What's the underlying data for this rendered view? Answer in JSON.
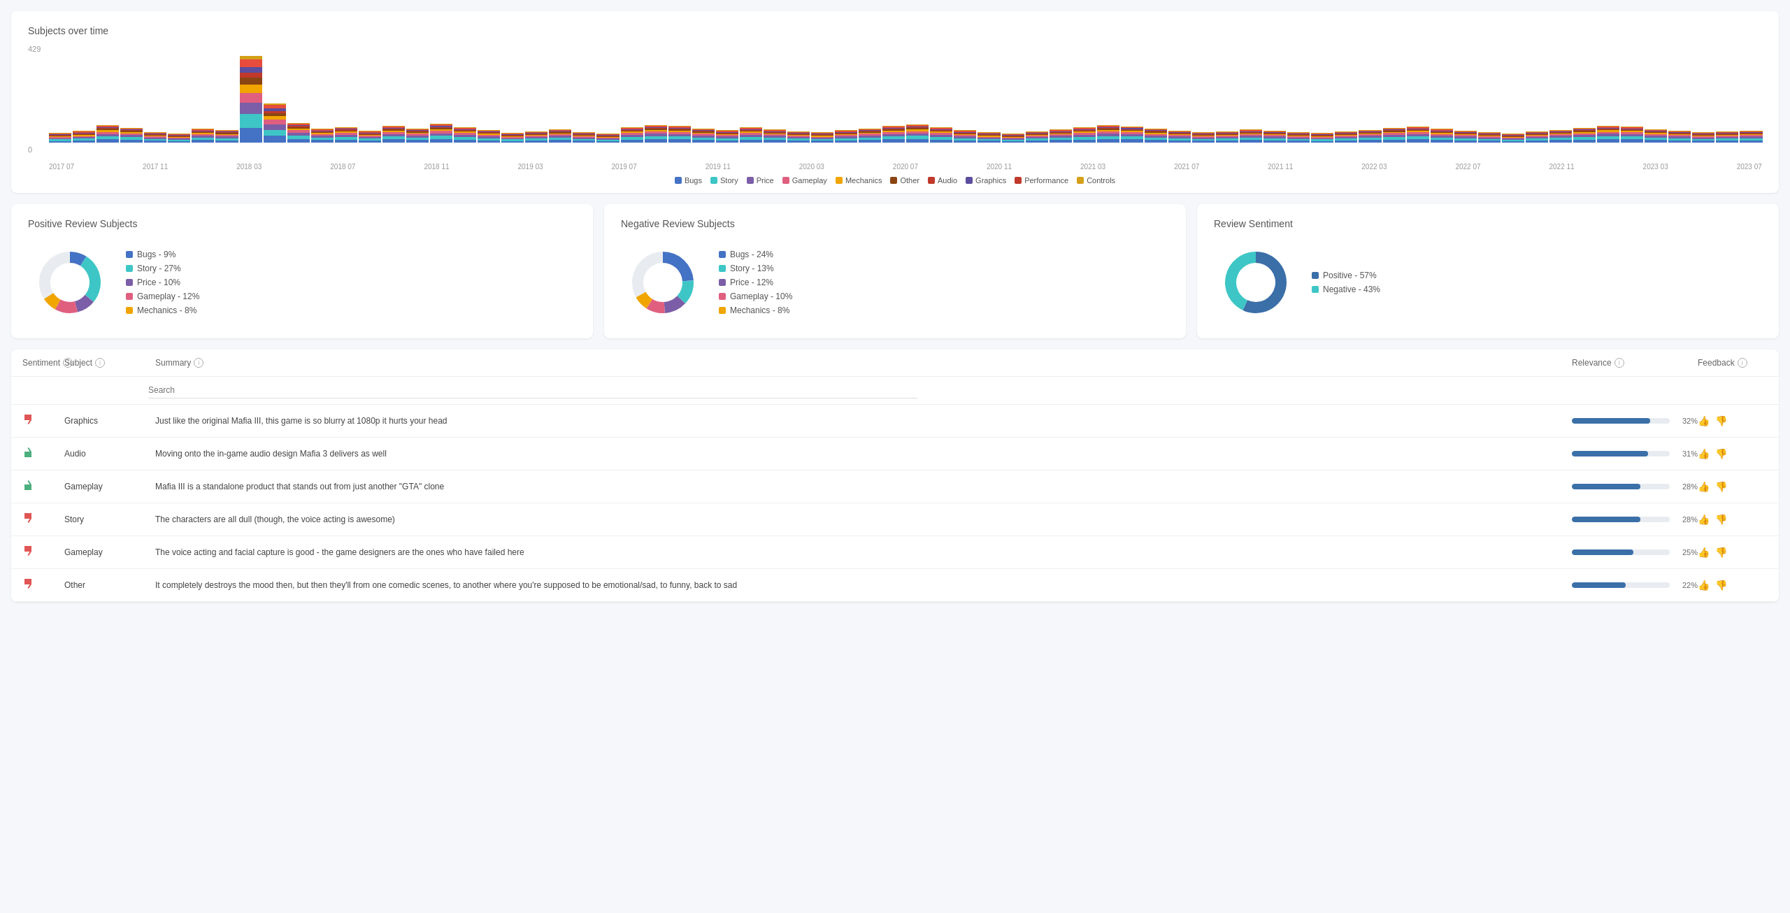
{
  "chart": {
    "title": "Subjects over time",
    "y_max": "429",
    "y_zero": "0",
    "x_labels": [
      "2017 07",
      "2017 11",
      "2018 03",
      "2018 07",
      "2018 11",
      "2019 03",
      "2019 07",
      "2019 11",
      "2020 03",
      "2020 07",
      "2020 11",
      "2021 03",
      "2021 07",
      "2021 11",
      "2022 03",
      "2022 07",
      "2022 11",
      "2023 03",
      "2023 07"
    ],
    "legend": [
      {
        "label": "Bugs",
        "color": "#4472c4"
      },
      {
        "label": "Story",
        "color": "#3ec6c6"
      },
      {
        "label": "Price",
        "color": "#7b5ea7"
      },
      {
        "label": "Gameplay",
        "color": "#e05f7f"
      },
      {
        "label": "Mechanics",
        "color": "#f0a500"
      },
      {
        "label": "Other",
        "color": "#8b4513"
      },
      {
        "label": "Audio",
        "color": "#c0392b"
      },
      {
        "label": "Graphics",
        "color": "#5c4d9e"
      },
      {
        "label": "Performance",
        "color": "#c0392b"
      },
      {
        "label": "Controls",
        "color": "#d4a017"
      }
    ]
  },
  "positive_subjects": {
    "title": "Positive Review Subjects",
    "legend": [
      {
        "label": "Bugs - 9%",
        "color": "#4472c4"
      },
      {
        "label": "Story - 27%",
        "color": "#3ec6c6"
      },
      {
        "label": "Price - 10%",
        "color": "#7b5ea7"
      },
      {
        "label": "Gameplay - 12%",
        "color": "#e05f7f"
      },
      {
        "label": "Mechanics - 8%",
        "color": "#f0a500"
      }
    ],
    "segments": [
      {
        "pct": 9,
        "color": "#4472c4"
      },
      {
        "pct": 27,
        "color": "#3ec6c6"
      },
      {
        "pct": 10,
        "color": "#7b5ea7"
      },
      {
        "pct": 12,
        "color": "#e05f7f"
      },
      {
        "pct": 8,
        "color": "#f0a500"
      },
      {
        "pct": 34,
        "color": "#e8ecf0"
      }
    ]
  },
  "negative_subjects": {
    "title": "Negative Review Subjects",
    "legend": [
      {
        "label": "Bugs - 24%",
        "color": "#4472c4"
      },
      {
        "label": "Story - 13%",
        "color": "#3ec6c6"
      },
      {
        "label": "Price - 12%",
        "color": "#7b5ea7"
      },
      {
        "label": "Gameplay - 10%",
        "color": "#e05f7f"
      },
      {
        "label": "Mechanics - 8%",
        "color": "#f0a500"
      }
    ],
    "segments": [
      {
        "pct": 24,
        "color": "#4472c4"
      },
      {
        "pct": 13,
        "color": "#3ec6c6"
      },
      {
        "pct": 12,
        "color": "#7b5ea7"
      },
      {
        "pct": 10,
        "color": "#e05f7f"
      },
      {
        "pct": 8,
        "color": "#f0a500"
      },
      {
        "pct": 33,
        "color": "#e8ecf0"
      }
    ]
  },
  "sentiment": {
    "title": "Review Sentiment",
    "legend": [
      {
        "label": "Positive - 57%",
        "color": "#3b6fa8"
      },
      {
        "label": "Negative - 43%",
        "color": "#3ec6c6"
      }
    ],
    "segments": [
      {
        "pct": 57,
        "color": "#3b6fa8"
      },
      {
        "pct": 43,
        "color": "#3ec6c6"
      }
    ]
  },
  "table": {
    "headers": {
      "sentiment": "Sentiment",
      "subject": "Subject",
      "summary": "Summary",
      "relevance": "Relevance",
      "feedback": "Feedback"
    },
    "search_placeholder": "Search",
    "rows": [
      {
        "sentiment": "neg",
        "subject": "Graphics",
        "summary": "Just like the original Mafia III, this game is so blurry at 1080p it hurts your head",
        "relevance": 32
      },
      {
        "sentiment": "pos",
        "subject": "Audio",
        "summary": "Moving onto the in-game audio design Mafia 3 delivers as well",
        "relevance": 31
      },
      {
        "sentiment": "pos",
        "subject": "Gameplay",
        "summary": "Mafia III is a standalone product that stands out from just another \"GTA\" clone",
        "relevance": 28
      },
      {
        "sentiment": "neg",
        "subject": "Story",
        "summary": "The characters are all dull (though, the voice acting is awesome)",
        "relevance": 28
      },
      {
        "sentiment": "neg",
        "subject": "Gameplay",
        "summary": "The voice acting and facial capture is good - the game designers are the ones who have failed here",
        "relevance": 25
      },
      {
        "sentiment": "neg",
        "subject": "Other",
        "summary": "It completely destroys the mood then, but then they'll from one comedic scenes, to another where you're supposed to be emotional/sad, to funny, back to sad",
        "relevance": 22
      }
    ]
  }
}
